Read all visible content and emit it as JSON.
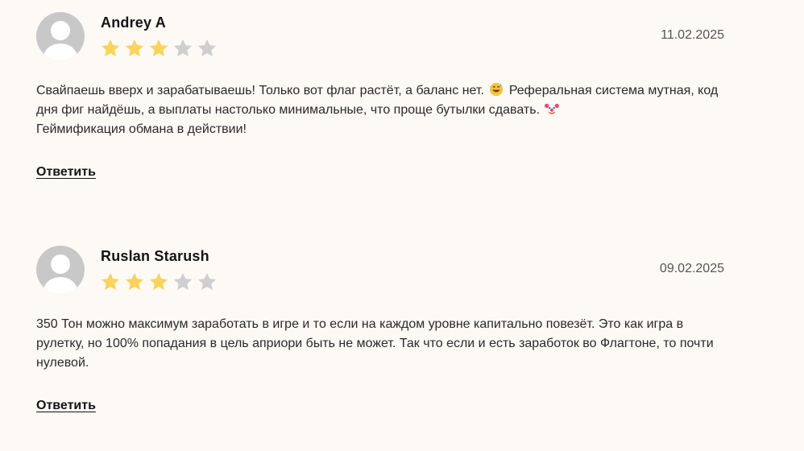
{
  "colors": {
    "star_filled": "#f9d35b",
    "star_empty": "#cfcfcf",
    "avatar_bg": "#c8c8c8"
  },
  "reviews": [
    {
      "author": "Andrey A",
      "rating": 3,
      "max_rating": 5,
      "date": "11.02.2025",
      "text_part1": "Свайпаешь вверх и зарабатываешь! Только вот флаг растёт, а баланс нет.",
      "emoji1": "grinning-sweat-emoji",
      "text_part2": "Реферальная система мутная, код дня фиг найдёшь, а выплаты настолько минимальные, что проще бутылки сдавать.",
      "emoji2": "clown-face-emoji",
      "text_part3": "Геймификация обмана в действии!",
      "reply_label": "Ответить"
    },
    {
      "author": "Ruslan Starush",
      "rating": 3,
      "max_rating": 5,
      "date": "09.02.2025",
      "text": "350 Тон можно максимум заработать в игре и то если на каждом уровне капитально повезёт. Это как игра в рулетку, но 100% попадания в цель априори быть не может. Так что если и есть заработок во Флагтоне, то почти нулевой.",
      "reply_label": "Ответить"
    }
  ]
}
